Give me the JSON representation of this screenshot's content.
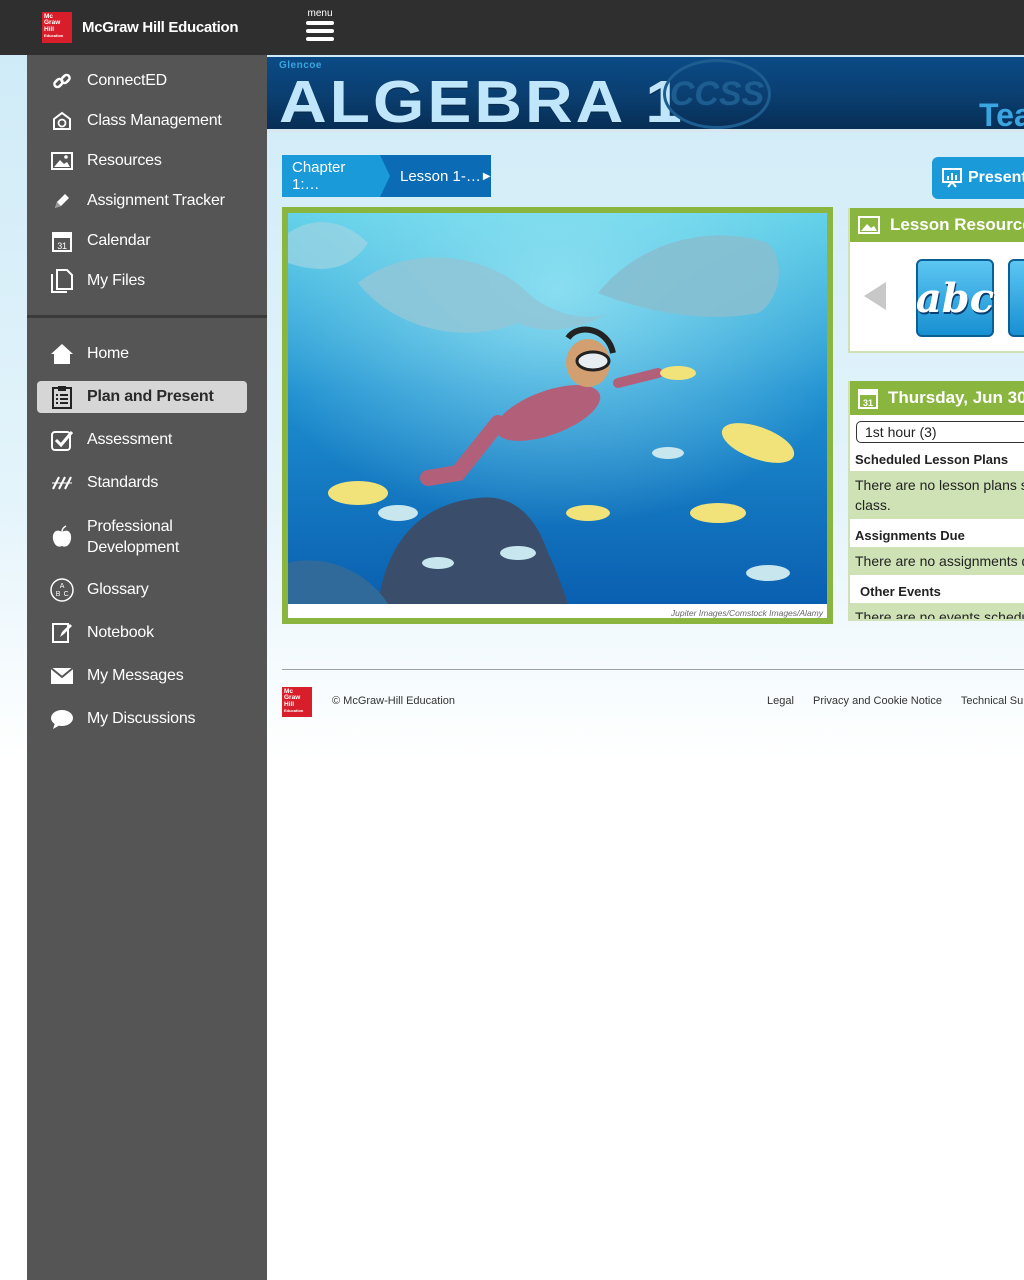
{
  "header": {
    "logo_lines": [
      "Mc",
      "Graw",
      "Hill",
      "Education"
    ],
    "brand_name": "McGraw Hill Education",
    "menu_label": "menu"
  },
  "sidebar": {
    "top_items": [
      {
        "label": "ConnectED",
        "icon": "link-icon"
      },
      {
        "label": "Class Management",
        "icon": "class-management-icon"
      },
      {
        "label": "Resources",
        "icon": "image-icon"
      },
      {
        "label": "Assignment Tracker",
        "icon": "pencil-icon"
      },
      {
        "label": "Calendar",
        "icon": "calendar-icon"
      },
      {
        "label": "My Files",
        "icon": "files-icon"
      }
    ],
    "bottom_items": [
      {
        "label": "Home",
        "icon": "home-icon"
      },
      {
        "label": "Plan and Present",
        "icon": "clipboard-icon",
        "active": true
      },
      {
        "label": "Assessment",
        "icon": "checkbox-icon"
      },
      {
        "label": "Standards",
        "icon": "standards-icon"
      },
      {
        "label": "Professional Development",
        "icon": "apple-icon"
      },
      {
        "label": "Glossary",
        "icon": "abc-icon"
      },
      {
        "label": "Notebook",
        "icon": "notebook-icon"
      },
      {
        "label": "My Messages",
        "icon": "envelope-icon"
      },
      {
        "label": "My Discussions",
        "icon": "chat-bubble-icon"
      }
    ]
  },
  "banner": {
    "publisher": "Glencoe",
    "title": "ALGEBRA 1",
    "badge": "CCSS",
    "edition_partial": "Tea"
  },
  "breadcrumb": {
    "chapter": "Chapter 1:…",
    "lesson": "Lesson 1-…"
  },
  "present_button": "Present",
  "hero": {
    "credit": "Jupiter Images/Comstock Images/Alamy"
  },
  "lesson_resources": {
    "title": "Lesson Resources",
    "tile_text": "abc"
  },
  "calendar_panel": {
    "date": "Thursday, Jun 30",
    "class_select": "1st hour (3)",
    "scheduled_heading": "Scheduled Lesson Plans",
    "scheduled_msg_line1": "There are no lesson plans s",
    "scheduled_msg_line2": "class.",
    "assignments_heading": "Assignments Due",
    "assignments_msg": "There are no assignments d",
    "events_heading": "Other Events",
    "events_msg": "There are no events schedu"
  },
  "footer": {
    "logo_lines": [
      "Mc",
      "Graw",
      "Hill",
      "Education"
    ],
    "copyright": "© McGraw-Hill Education",
    "links": [
      "Legal",
      "Privacy and Cookie Notice",
      "Technical Support"
    ]
  },
  "colors": {
    "topbar": "#2f2f2f",
    "sidebar": "#555555",
    "accent_green": "#8ab53f",
    "accent_blue": "#1a9ad9",
    "brand_red": "#d81e2a"
  }
}
